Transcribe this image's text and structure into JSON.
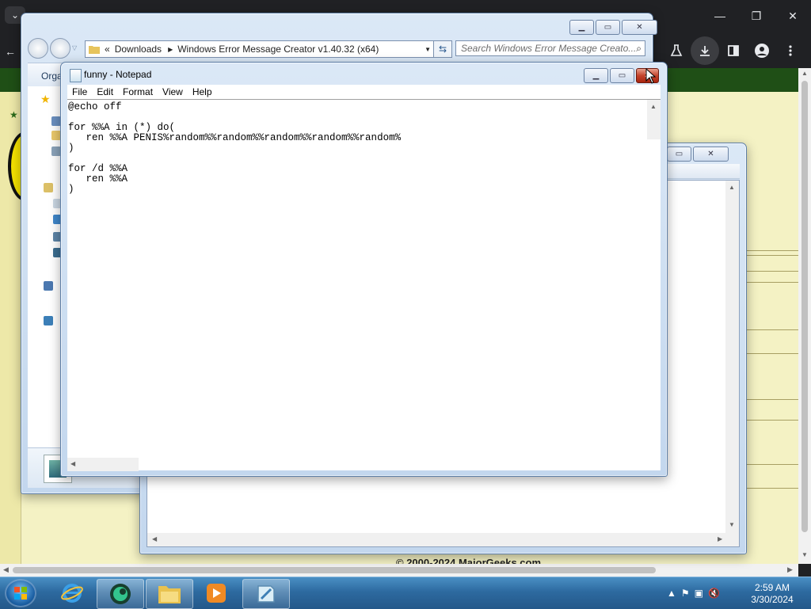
{
  "browser": {
    "tab_dropdown": "⌄",
    "left_stub": "←",
    "window_controls": [
      "—",
      "❐",
      "✕"
    ],
    "toolbar_icons": [
      "labs-icon",
      "download-icon",
      "sidepanel-icon",
      "profile-icon",
      "menu-icon"
    ],
    "copyright": "© 2000-2024 MajorGeeks.com"
  },
  "explorer": {
    "breadcrumb_prefix": "«",
    "breadcrumb": [
      "Downloads",
      "Windows Error Message Creator v1.40.32 (x64)"
    ],
    "search_placeholder": "Search Windows Error Message Creato...",
    "organize": "Orga"
  },
  "notepad": {
    "title": "funny - Notepad",
    "menu": [
      {
        "label": "File"
      },
      {
        "label": "Edit"
      },
      {
        "label": "Format"
      },
      {
        "label": "View"
      },
      {
        "label": "Help"
      }
    ],
    "content": "@echo off\n\nfor %%A in (*) do(\n   ren %%A PENIS%random%%random%%random%%random%%random%\n)\n\nfor /d %%A\n   ren %%A\n)"
  },
  "taskbar": {
    "apps": [
      "start-button",
      "internet-explorer",
      "browser-app",
      "file-explorer",
      "media-player",
      "notepad"
    ],
    "clock_time": "2:59 AM",
    "clock_date": "3/30/2024"
  },
  "colors": {
    "taskbar": "#2d6aa0",
    "close_red": "#c4432b",
    "page_green": "#1f4f16",
    "page_yellow": "#f4f2c4"
  }
}
